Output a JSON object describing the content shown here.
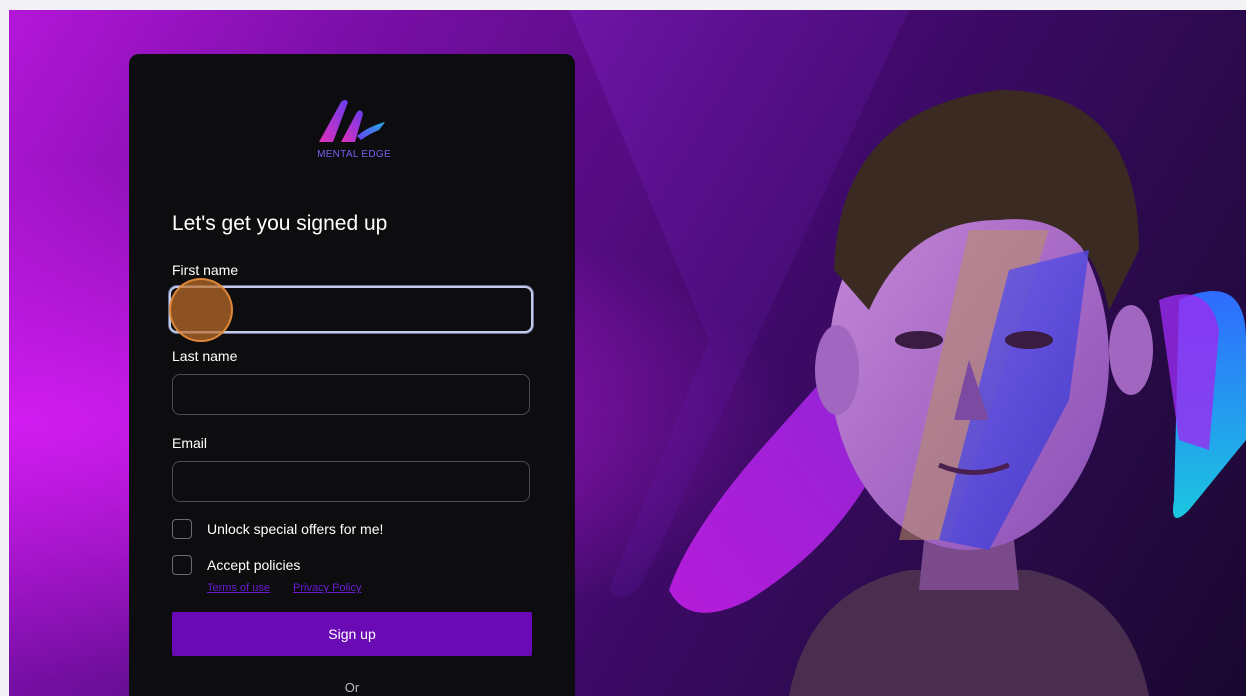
{
  "brand": {
    "logo_text": "MENTAL EDGE"
  },
  "form": {
    "heading": "Let's get you signed up",
    "first_name": {
      "label": "First name",
      "value": ""
    },
    "last_name": {
      "label": "Last name",
      "value": ""
    },
    "email": {
      "label": "Email",
      "value": ""
    },
    "offers_checkbox": {
      "label": "Unlock special offers for me!",
      "checked": false
    },
    "policies_checkbox": {
      "label": "Accept policies",
      "checked": false
    },
    "links": {
      "terms": "Terms of use",
      "privacy": "Privacy Policy"
    },
    "submit_label": "Sign up",
    "divider_text": "Or"
  },
  "colors": {
    "accent": "#6a0ab4",
    "card_bg": "#0d0d0f",
    "link": "#6a1bd1",
    "background_primary": "#b416d8"
  },
  "icons": {
    "logo": "mental-edge-logo-icon"
  }
}
